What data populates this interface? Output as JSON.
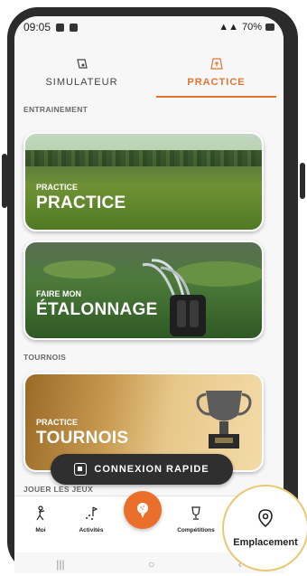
{
  "status": {
    "time": "09:05",
    "battery": "70%"
  },
  "tabs": [
    {
      "label": "SIMULATEUR",
      "icon": "simulator-icon"
    },
    {
      "label": "PRACTICE",
      "icon": "practice-icon",
      "active": true
    }
  ],
  "sections": {
    "training": "ENTRAINEMENT",
    "tournaments": "TOURNOIS",
    "games": "JOUER LES JEUX"
  },
  "cards": {
    "practice": {
      "small": "PRACTICE",
      "big": "PRACTICE"
    },
    "etalonnage": {
      "small": "FAIRE MON",
      "big": "ÉTALONNAGE"
    },
    "tournois": {
      "small": "PRACTICE",
      "big": "TOURNOIS"
    }
  },
  "quick_connect": "CONNEXION RAPIDE",
  "nav": {
    "moi": "Moi",
    "activites": "Activités",
    "competitions": "Compétitions",
    "emplacement": "Emplacement"
  },
  "colors": {
    "accent": "#e27430",
    "nav_center": "#e96f2a"
  }
}
